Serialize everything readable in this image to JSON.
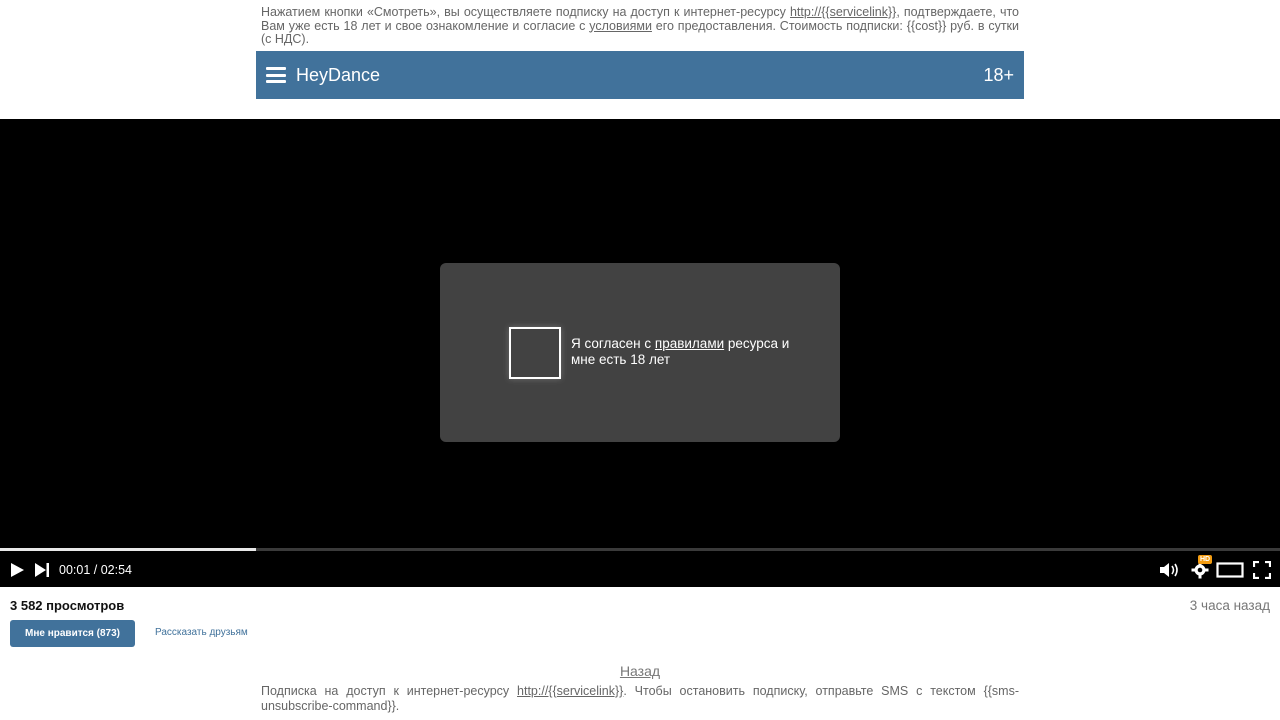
{
  "disclaimer": {
    "part1": "Нажатием кнопки «Смотреть», вы осуществляете подписку на доступ к интернет-ресурсу ",
    "link_service": "http://{{servicelink}}",
    "part2": ", подтверждаете, что Вам уже есть 18 лет и свое ознакомление и согласие с ",
    "link_terms": "условиями",
    "part3": " его предоставления. Стоимость подписки: {{cost}} руб. в сутки (с НДС)."
  },
  "header": {
    "brand": "HeyDance",
    "age_badge": "18+",
    "color": "#41729b"
  },
  "player": {
    "consent": {
      "text_before": "Я согласен с ",
      "link_rules": "правилами",
      "text_after": " ресурса и мне есть 18 лет"
    },
    "progress_fraction": 0.2,
    "time_display": "00:01 / 02:54",
    "icons": {
      "play": "play-icon",
      "next": "next-icon",
      "volume": "volume-icon",
      "settings": "gear-icon",
      "hd": "HD",
      "theater": "theater-mode-icon",
      "fullscreen": "fullscreen-icon"
    }
  },
  "meta": {
    "views": "3 582 просмотров",
    "posted_ago": "3 часа назад",
    "like_label": "Мне нравится (873)",
    "share_label": "Рассказать друзьям"
  },
  "footer": {
    "back_label": "Назад",
    "note_part1": "Подписка на доступ к интернет-ресурсу ",
    "note_link": "http://{{servicelink}}",
    "note_part2": ". Чтобы остановить подписку, отправьте SMS с текстом {{sms-unsubscribe-command}}."
  }
}
